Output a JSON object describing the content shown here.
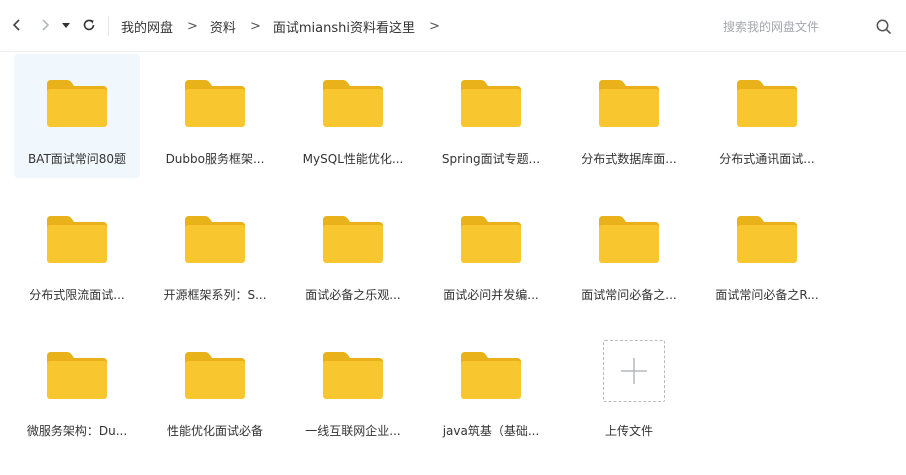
{
  "breadcrumb": [
    "我的网盘",
    "资料",
    "面试mianshi资料看这里"
  ],
  "search": {
    "placeholder": "搜索我的网盘文件"
  },
  "folders": [
    {
      "name": "BAT面试常问80题",
      "selected": true
    },
    {
      "name": "Dubbo服务框架..."
    },
    {
      "name": "MySQL性能优化..."
    },
    {
      "name": "Spring面试专题..."
    },
    {
      "name": "分布式数据库面..."
    },
    {
      "name": "分布式通讯面试..."
    },
    {
      "name": "分布式限流面试..."
    },
    {
      "name": "开源框架系列：S..."
    },
    {
      "name": "面试必备之乐观..."
    },
    {
      "name": "面试必问并发编..."
    },
    {
      "name": "面试常问必备之..."
    },
    {
      "name": "面试常问必备之R..."
    },
    {
      "name": "微服务架构：Du..."
    },
    {
      "name": "性能优化面试必备"
    },
    {
      "name": "一线互联网企业..."
    },
    {
      "name": "java筑基（基础..."
    }
  ],
  "upload": {
    "label": "上传文件"
  },
  "colors": {
    "folder": "#F8C72F",
    "folder_tab": "#E9B21A",
    "selected_bg": "#F1F8FD"
  },
  "icons": {
    "back": "chevron-left-icon",
    "forward": "chevron-right-icon",
    "history": "caret-down-icon",
    "refresh": "refresh-icon",
    "search": "search-icon",
    "folder": "folder-icon",
    "upload": "plus-icon"
  }
}
